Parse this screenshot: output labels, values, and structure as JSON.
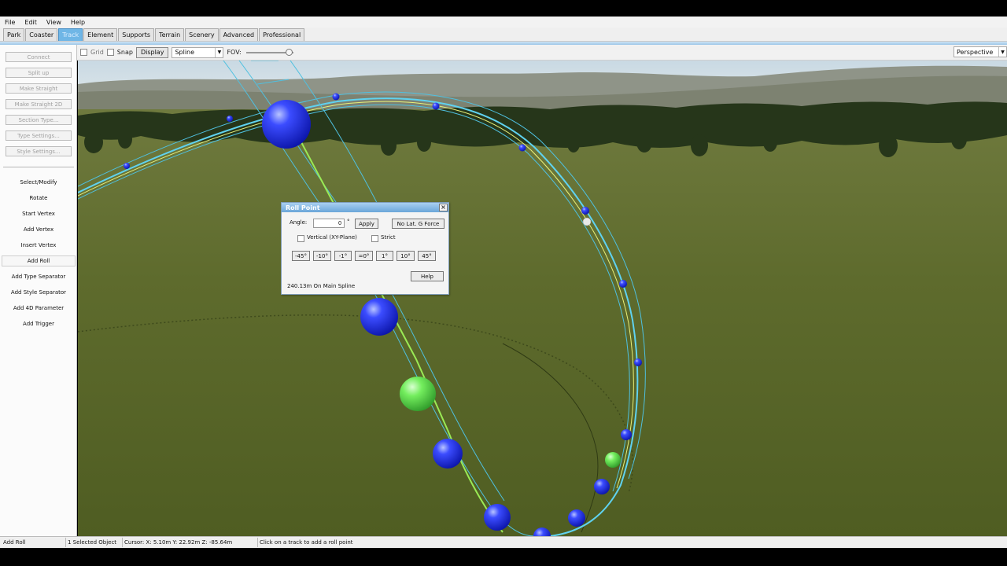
{
  "menu": [
    "File",
    "Edit",
    "View",
    "Help"
  ],
  "tabs": [
    {
      "label": "Park",
      "active": false
    },
    {
      "label": "Coaster",
      "active": false
    },
    {
      "label": "Track",
      "active": true
    },
    {
      "label": "Element",
      "active": false
    },
    {
      "label": "Supports",
      "active": false
    },
    {
      "label": "Terrain",
      "active": false
    },
    {
      "label": "Scenery",
      "active": false
    },
    {
      "label": "Advanced",
      "active": false
    },
    {
      "label": "Professional",
      "active": false
    }
  ],
  "toolbar": {
    "grid_label": "Grid",
    "snap_label": "Snap",
    "display_button": "Display",
    "mode_select": "Spline",
    "fov_label": "FOV:",
    "fov_level": 0.9,
    "view_select": "Perspective"
  },
  "sidebar": {
    "top_buttons": [
      "Connect",
      "Split up",
      "Make Straight",
      "Make Straight 2D",
      "Section Type...",
      "Type Settings...",
      "Style Settings..."
    ],
    "tools": [
      "Select/Modify",
      "Rotate",
      "Start Vertex",
      "Add Vertex",
      "Insert Vertex",
      "Add Roll",
      "Add Type Separator",
      "Add Style Separator",
      "Add 4D Parameter",
      "Add Trigger"
    ],
    "selected_tool": "Add Roll"
  },
  "dialog": {
    "title": "Roll Point",
    "close": "×",
    "angle_label": "Angle:",
    "angle_value": "0",
    "degree_symbol": "°",
    "apply_button": "Apply",
    "no_lat_button": "No Lat. G Force",
    "vertical_label": "Vertical (XY-Plane)",
    "strict_label": "Strict",
    "step_buttons": [
      "-45°",
      "-10°",
      "-1°",
      "=0°",
      "1°",
      "10°",
      "45°"
    ],
    "help_button": "Help",
    "position_text": "240.13m On Main Spline"
  },
  "statusbar": {
    "mode": "Add Roll",
    "selection": "1 Selected Object",
    "cursor": "Cursor: X: 5.10m Y: 22.92m Z: -85.64m",
    "hint": "Click on a track to add a roll point"
  },
  "colors": {
    "tab_active": "#6fb6e6",
    "sky": "#d7e4ea",
    "grass": "#5c6b2a",
    "vertex_blue": "#1a2df0",
    "roll_green": "#6ef06a",
    "track_cyan": "#4fc8e8"
  }
}
